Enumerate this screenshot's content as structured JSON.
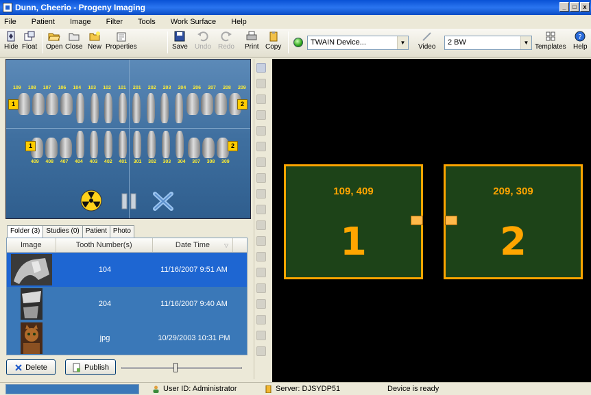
{
  "window": {
    "title": "Dunn, Cheerio - Progeny Imaging",
    "controls": [
      "_",
      "□",
      "x"
    ]
  },
  "menu": [
    "File",
    "Patient",
    "Image",
    "Filter",
    "Tools",
    "Work Surface",
    "Help"
  ],
  "toolbar": {
    "hide": "Hide",
    "float": "Float",
    "open": "Open",
    "close": "Close",
    "new": "New",
    "properties": "Properties",
    "save": "Save",
    "undo": "Undo",
    "redo": "Redo",
    "print": "Print",
    "copy": "Copy",
    "device": "TWAIN Device...",
    "video": "Video",
    "template_select": "2 BW",
    "templates": "Templates",
    "help": "Help"
  },
  "tooth_chart": {
    "upper_numbers": [
      "109",
      "108",
      "107",
      "106",
      "104",
      "103",
      "102",
      "101",
      "201",
      "202",
      "203",
      "204",
      "206",
      "207",
      "208",
      "209"
    ],
    "lower_numbers": [
      "409",
      "408",
      "407",
      "404",
      "403",
      "402",
      "401",
      "301",
      "302",
      "303",
      "304",
      "307",
      "308",
      "309"
    ],
    "markers": {
      "upper_left": "1",
      "upper_right": "2",
      "lower_left": "1",
      "lower_right": "2"
    }
  },
  "tabs": [
    "Folder (3)",
    "Studies (0)",
    "Patient",
    "Photo"
  ],
  "folder": {
    "columns": [
      "Image",
      "Tooth Number(s)",
      "Date Time"
    ],
    "rows": [
      {
        "tooth": "104",
        "date": "11/16/2007 9:51 AM",
        "selected": true
      },
      {
        "tooth": "204",
        "date": "11/16/2007 9:40 AM",
        "selected": false
      },
      {
        "tooth": "jpg",
        "date": "10/29/2003 10:31 PM",
        "selected": false
      }
    ]
  },
  "buttons": {
    "delete": "Delete",
    "publish": "Publish"
  },
  "zoom_slider": {
    "value": 0.45
  },
  "mounts": [
    {
      "teeth": "109, 409",
      "number": "1"
    },
    {
      "teeth": "209, 309",
      "number": "2"
    }
  ],
  "status": {
    "user": "User ID:  Administrator",
    "server": "Server:  DJSYDP51",
    "device": "Device is ready"
  },
  "colors": {
    "accent": "#ffa500",
    "mount_bg": "#1d4318",
    "selection": "#1e66d2",
    "chart_bg": "#3f6f9f"
  }
}
